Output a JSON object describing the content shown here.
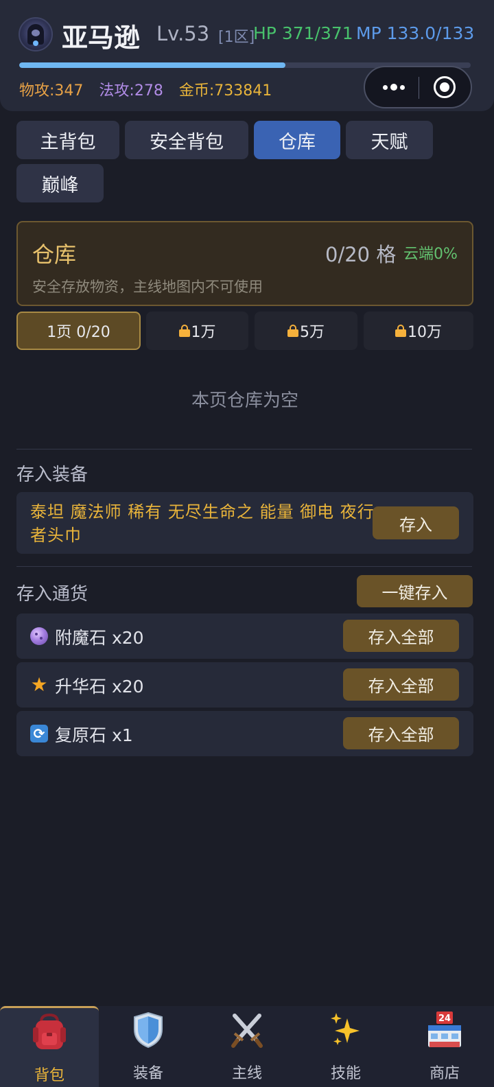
{
  "header": {
    "name": "亚马逊",
    "level": "Lv.53",
    "zone": "[1区]",
    "hp": "HP 371/371",
    "mp": "MP 133.0/133",
    "xp_fraction": 0.59,
    "phy_attack": "物攻:347",
    "mag_attack": "法攻:278",
    "gold": "金币:733841"
  },
  "tabs": [
    {
      "label": "主背包",
      "active": false
    },
    {
      "label": "安全背包",
      "active": false
    },
    {
      "label": "仓库",
      "active": true
    },
    {
      "label": "天赋",
      "active": false
    },
    {
      "label": "巅峰",
      "active": false
    }
  ],
  "warehouse": {
    "title": "仓库",
    "count": "0/20 格",
    "cloud": "云端0%",
    "description": "安全存放物资，主线地图内不可使用"
  },
  "pages": [
    {
      "label": "1页 0/20",
      "locked": false,
      "active": true
    },
    {
      "label": "1万",
      "locked": true,
      "active": false
    },
    {
      "label": "5万",
      "locked": true,
      "active": false
    },
    {
      "label": "10万",
      "locked": true,
      "active": false
    }
  ],
  "empty_text": "本页仓库为空",
  "deposit_equipment": {
    "title": "存入装备",
    "item_name": "泰坦 魔法师 稀有 无尽生命之 能量 御电 夜行者头巾",
    "button": "存入"
  },
  "deposit_currency": {
    "title": "存入通货",
    "all_button": "一键存入",
    "items": [
      {
        "icon": "enchant-stone-icon",
        "name": "附魔石 x20",
        "button": "存入全部"
      },
      {
        "icon": "star-icon",
        "name": "升华石 x20",
        "button": "存入全部"
      },
      {
        "icon": "restore-icon",
        "name": "复原石 x1",
        "button": "存入全部"
      }
    ]
  },
  "nav": [
    {
      "label": "背包",
      "icon": "backpack-icon",
      "active": true
    },
    {
      "label": "装备",
      "icon": "shield-icon",
      "active": false
    },
    {
      "label": "主线",
      "icon": "crossed-swords-icon",
      "active": false
    },
    {
      "label": "技能",
      "icon": "sparkles-icon",
      "active": false
    },
    {
      "label": "商店",
      "icon": "store-icon",
      "active": false
    }
  ],
  "colors": {
    "hp": "#48c26c",
    "mp": "#5d9bea",
    "gold": "#e8b43a",
    "tab_active": "#3a63b3",
    "button_gold": "#6a5328"
  }
}
